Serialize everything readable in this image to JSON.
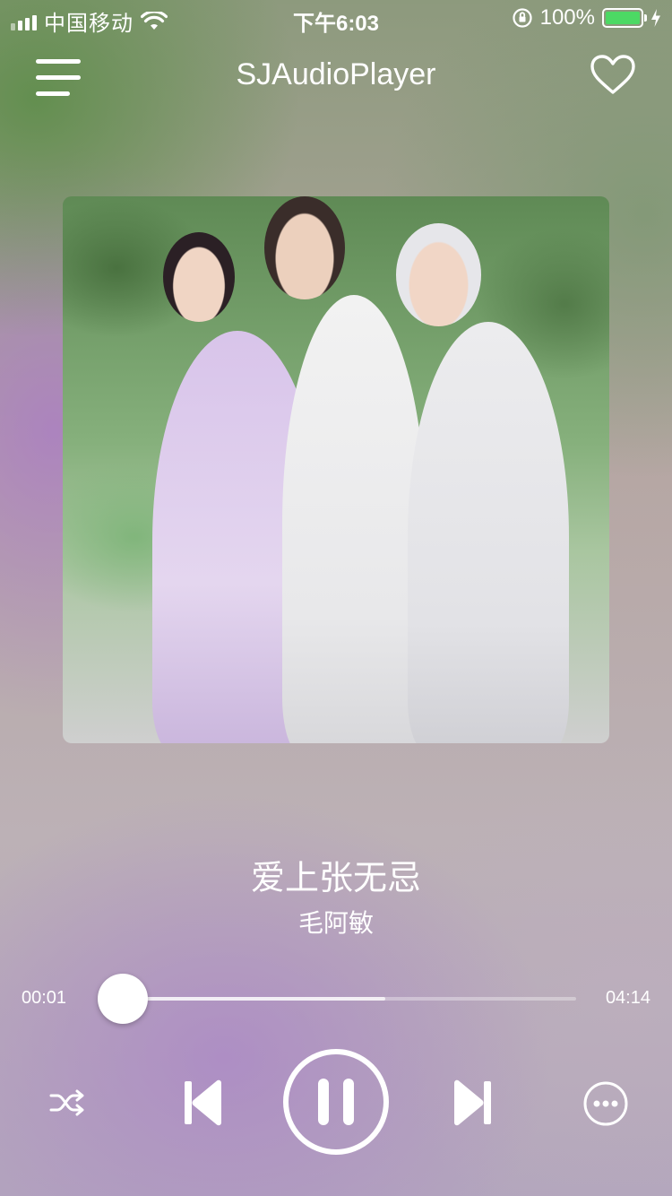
{
  "status_bar": {
    "carrier": "中国移动",
    "time": "下午6:03",
    "battery_percent": "100%",
    "battery_level": 1.0,
    "battery_color": "#4cd964",
    "icons": [
      "signal-bars-icon",
      "wifi-icon",
      "orientation-lock-icon",
      "battery-icon",
      "charging-bolt-icon"
    ]
  },
  "nav": {
    "title": "SJAudioPlayer",
    "icons": [
      "menu-icon",
      "heart-icon"
    ]
  },
  "track": {
    "title": "爱上张无忌",
    "artist": "毛阿敏",
    "cover_icon": "album-art"
  },
  "progress": {
    "current_time": "00:01",
    "total_time": "04:14",
    "played_fraction": 0.004,
    "buffered_fraction": 0.58
  },
  "controls": {
    "icons": [
      "shuffle-icon",
      "previous-track-icon",
      "pause-icon",
      "next-track-icon",
      "more-icon"
    ]
  }
}
